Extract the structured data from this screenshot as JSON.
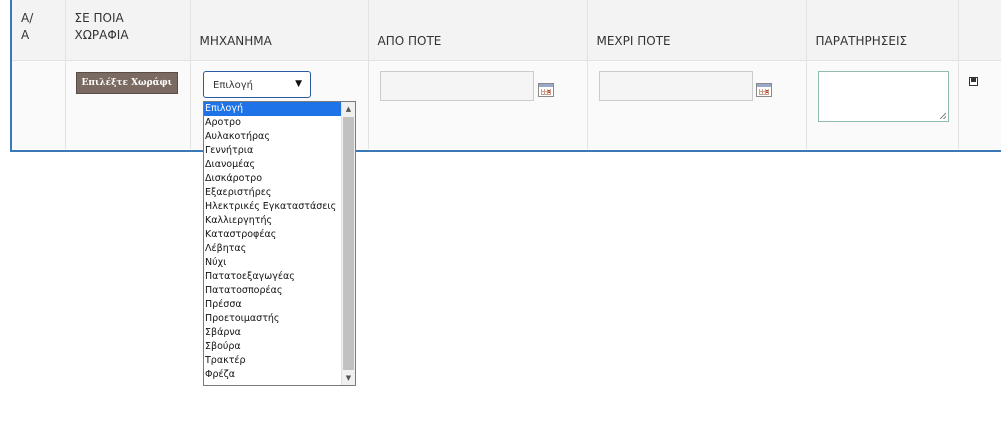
{
  "table": {
    "headers": {
      "aa": "Α/Α",
      "field": "ΣΕ ΠΟΙΑ ΧΩΡΑΦΙΑ",
      "machine": "ΜΗΧΑΝΗΜΑ",
      "from": "ΑΠΟ ΠΟΤΕ",
      "to": "ΜΕΧΡΙ ΠΟΤΕ",
      "notes": "ΠΑΡΑΤΗΡΗΣΕΙΣ"
    },
    "aa_lines": [
      "Α/",
      "Α"
    ],
    "field_lines": [
      "ΣΕ ΠΟΙΑ",
      "ΧΩΡΑΦΙΑ"
    ]
  },
  "row": {
    "select_field_label": "Επιλέξτε Χωράφι",
    "machine_selected": "Επιλογή",
    "from_value": "",
    "to_value": "",
    "notes_value": ""
  },
  "dropdown": {
    "options": [
      "Επιλογή",
      "Αροτρο",
      "Αυλακοτήρας",
      "Γεννήτρια",
      "Διανομέας",
      "Δισκάροτρο",
      "Εξαεριστήρες",
      "Ηλεκτρικές Εγκαταστάσεις",
      "Καλλιεργητής",
      "Καταστροφέας",
      "Λέβητας",
      "Νύχι",
      "Πατατοεξαγωγέας",
      "Πατατοσπορέας",
      "Πρέσσα",
      "Προετοιμαστής",
      "Σβάρνα",
      "Σβούρα",
      "Τρακτέρ",
      "Φρέζα"
    ],
    "selected_index": 0
  },
  "icons": {
    "arrow_down": "▼",
    "scroll_up": "▲",
    "scroll_down": "▼"
  },
  "colors": {
    "frame_border": "#3a78b8",
    "selected_option": "#1e73e8",
    "field_button": "#7a6a62"
  }
}
